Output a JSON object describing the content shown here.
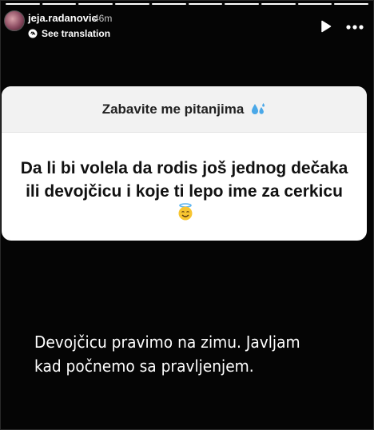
{
  "story": {
    "progress_segments": [
      1,
      1,
      1,
      1,
      1,
      1,
      1,
      1,
      1,
      1
    ],
    "author": {
      "username": "jeja.radanovic",
      "posted_ago": "46m",
      "avatar_icon": "avatar"
    },
    "translate_label": "See translation",
    "controls": {
      "play_icon": "play-icon",
      "more_icon": "more-options-icon"
    }
  },
  "question_sticker": {
    "title": "Zabavite me pitanjima",
    "title_icon": "water-drops-emoji",
    "question": "Da li bi volela da rodis još jednog dečaka ili devojčicu i koje ti lepo ime za cerkicu",
    "question_icon": "smiling-face-with-halo-emoji"
  },
  "answer_text": "Devojčicu pravimo na zimu. Javljam kad počnemo sa pravljenjem.",
  "colors": {
    "background": "#000000",
    "sticker_header": "#f2f2f2",
    "sticker_body": "#ffffff",
    "drops_blue": "#4aa8e8",
    "emoji_yellow": "#f7c531"
  }
}
